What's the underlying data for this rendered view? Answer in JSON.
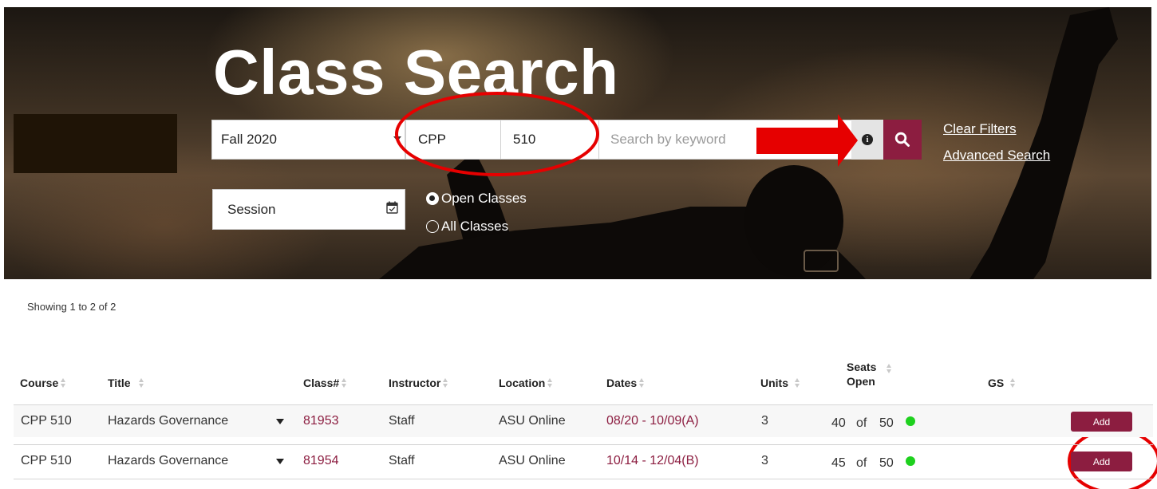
{
  "hero": {
    "title": "Class Search",
    "term": "Fall 2020",
    "subject": "CPP",
    "catalog_number": "510",
    "keyword_placeholder": "Search by keyword",
    "clear_filters": "Clear Filters",
    "advanced_search": "Advanced Search",
    "session_label": "Session",
    "radio_open": "Open Classes",
    "radio_all": "All Classes",
    "selected_radio": "Open Classes"
  },
  "results": {
    "showing": "Showing 1 to 2 of 2",
    "columns": {
      "course": "Course",
      "title": "Title",
      "class_no": "Class#",
      "instructor": "Instructor",
      "location": "Location",
      "dates": "Dates",
      "units": "Units",
      "seats_line1": "Seats",
      "seats_line2": "Open",
      "gs": "GS"
    },
    "rows": [
      {
        "course": "CPP 510",
        "title": "Hazards Governance",
        "class_no": "81953",
        "instructor": "Staff",
        "location": "ASU Online",
        "dates": "08/20 - 10/09(A)",
        "units": "3",
        "seats_open": "40",
        "seats_of": "of",
        "seats_total": "50",
        "add_label": "Add"
      },
      {
        "course": "CPP 510",
        "title": "Hazards Governance",
        "class_no": "81954",
        "instructor": "Staff",
        "location": "ASU Online",
        "dates": "10/14 - 12/04(B)",
        "units": "3",
        "seats_open": "45",
        "seats_of": "of",
        "seats_total": "50",
        "add_label": "Add"
      }
    ]
  },
  "icons": {
    "calendar": "calendar-icon",
    "search": "search-icon",
    "info": "info-icon",
    "expand": "chevron-down-icon",
    "availability": "status-dot-icon"
  },
  "colors": {
    "brand_maroon": "#8c1d40",
    "annotation_red": "#e60000",
    "seat_available": "#1ed11e"
  }
}
